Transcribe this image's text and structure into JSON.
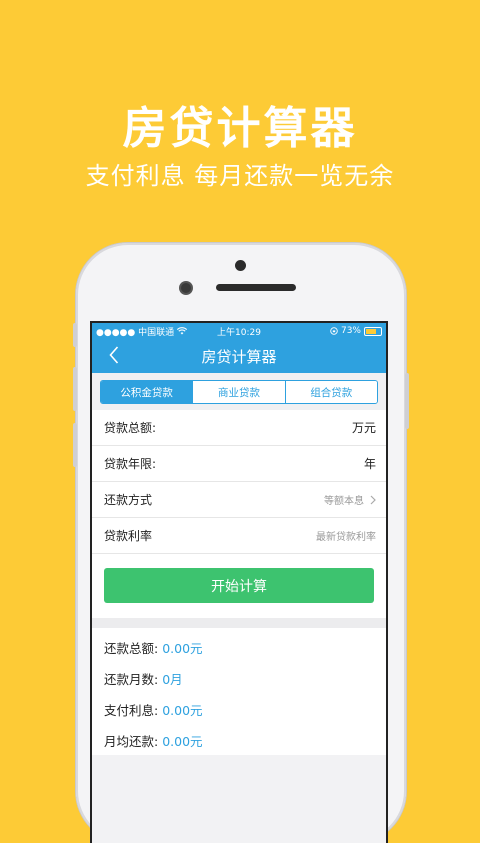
{
  "promo": {
    "title": "房贷计算器",
    "subtitle": "支付利息 每月还款一览无余"
  },
  "status_bar": {
    "carrier": "●●●●● 中国联通",
    "time": "上午10:29",
    "battery": "73%"
  },
  "nav": {
    "back_icon": "chevron-left-icon",
    "title": "房贷计算器"
  },
  "tabs": [
    {
      "label": "公积金贷款",
      "active": true
    },
    {
      "label": "商业贷款",
      "active": false
    },
    {
      "label": "组合贷款",
      "active": false
    }
  ],
  "form": {
    "loan_amount": {
      "label": "贷款总额:",
      "unit": "万元"
    },
    "loan_years": {
      "label": "贷款年限:",
      "unit": "年"
    },
    "repay_method": {
      "label": "还款方式",
      "value": "等额本息"
    },
    "rate": {
      "label": "贷款利率",
      "value": "最新贷款利率"
    }
  },
  "calculate_label": "开始计算",
  "results": {
    "total": {
      "label": "还款总额:",
      "value": "0.00元"
    },
    "months": {
      "label": "还款月数:",
      "value": "0月"
    },
    "interest": {
      "label": "支付利息:",
      "value": "0.00元"
    },
    "monthly": {
      "label": "月均还款:",
      "value": "0.00元"
    }
  },
  "colors": {
    "background": "#FDCB36",
    "primary": "#2EA1DF",
    "button": "#3DC36F"
  }
}
